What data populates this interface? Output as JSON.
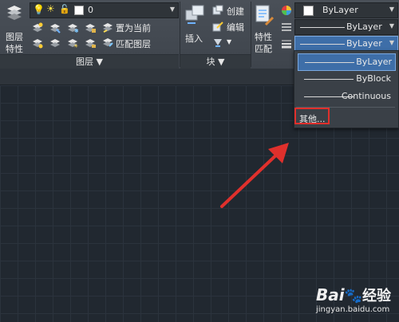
{
  "ribbon": {
    "layer_properties_label_line1": "图层",
    "layer_properties_label_line2": "特性",
    "layer_combo_value": "0",
    "set_current_label": "置为当前",
    "match_layer_label": "匹配图层",
    "layers_panel_label": "图层 ▼",
    "insert_label": "插入",
    "create_label": "创建",
    "edit_label": "编辑",
    "block_panel_label": "块 ▼",
    "match_properties_line1": "特性",
    "match_properties_line2": "匹配",
    "color_combo_value": "ByLayer",
    "linetype_combo_value": "ByLayer",
    "lineweight_combo_value": "ByLayer"
  },
  "dropdown": {
    "options": [
      "ByLayer",
      "ByBlock",
      "Continuous"
    ],
    "selected": "ByLayer",
    "other_label": "其他..."
  },
  "watermark": {
    "brand": "Bai",
    "brand_suffix": "经验",
    "url": "jingyan.baidu.com"
  },
  "colors": {
    "ribbon_bg": "#454b53",
    "canvas_bg": "#212830",
    "selection": "#3e6ea8",
    "highlight_box": "#e0302c",
    "arrow": "#e0302c"
  }
}
